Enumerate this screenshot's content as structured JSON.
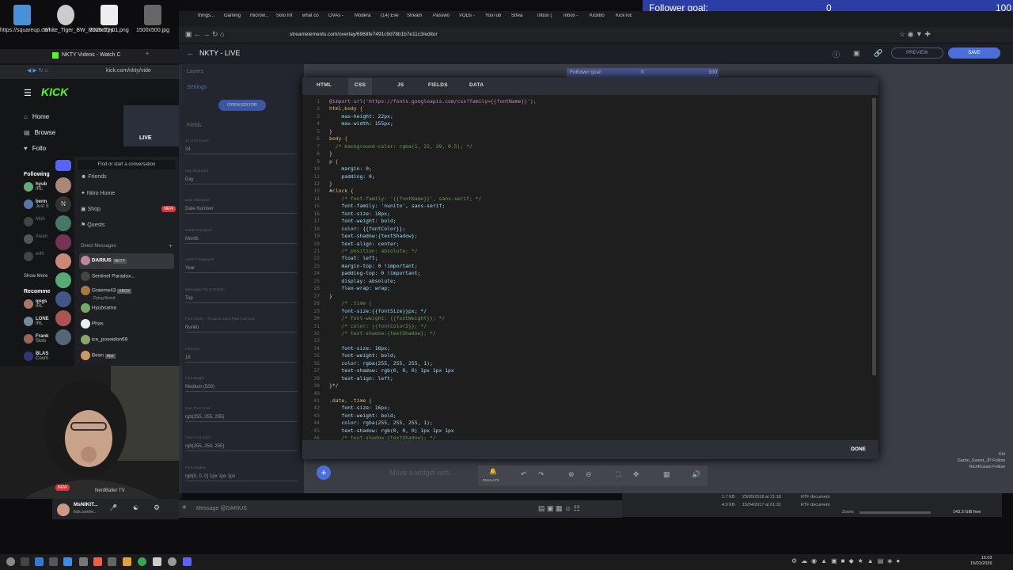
{
  "desktop": {
    "icons": [
      {
        "label": "https://squareup.com..."
      },
      {
        "label": "White_Tiger_BW_RoundTyp..."
      },
      {
        "label": "2025-12-01.png"
      },
      {
        "label": "1500x500.jpg"
      }
    ]
  },
  "follower_goal": {
    "label": "Follower goal:",
    "current": "0",
    "target": "100"
  },
  "browser": {
    "tabs": [
      "things...",
      "Gaming",
      "microw...",
      "Solo Inf",
      "what co",
      "OVAs -",
      "Modera",
      "(14) Eve",
      "Stream",
      "Passwo",
      "VODs -",
      "YouTub",
      "Strea",
      "Inbox (",
      "Inbox -",
      "KickBo",
      "KickToc"
    ],
    "url": "streamelements.com/overlay/6968fe7491c9d78b1b7e11c3/editor"
  },
  "kick": {
    "tab_title": "NKTY Videos - Watch C",
    "url": "kick.com/nkty/vide",
    "logo": "KICK",
    "nav": [
      "Home",
      "Browse",
      "Follo"
    ],
    "following_label": "Following",
    "following": [
      {
        "name": "hyub",
        "sub": "IRL"
      },
      {
        "name": "benn",
        "sub": "Just S"
      },
      {
        "name": "Moh",
        "sub": ""
      },
      {
        "name": "Asian",
        "sub": ""
      },
      {
        "name": "with",
        "sub": ""
      }
    ],
    "show_more": "Show More",
    "recommended_label": "Recomme",
    "recommended": [
      {
        "name": "qogs",
        "sub": "IRL"
      },
      {
        "name": "LONE",
        "sub": "IRL"
      },
      {
        "name": "Frank",
        "sub": "Slots"
      },
      {
        "name": "BLAS",
        "sub": "Count"
      }
    ],
    "live_badge": "LIVE"
  },
  "discord": {
    "search": "Find or start a conversation",
    "menu": [
      "Friends",
      "Nitro Home",
      "Shop",
      "Quests"
    ],
    "shop_badge": "NEW",
    "dm_header": "Direct Messages",
    "dms": [
      {
        "name": "DARIUS",
        "tag": "NKTY"
      },
      {
        "name": "Sentinel Paradox..."
      },
      {
        "name": "Graeme43",
        "tag": "XBOX",
        "sub": "Dying Breed"
      },
      {
        "name": "Hyubsama"
      },
      {
        "name": "Phas"
      },
      {
        "name": "ice_poseidon69"
      },
      {
        "name": "Bean",
        "tag": "Ape"
      },
      {
        "name": "NerdBaller TV"
      }
    ],
    "user_name": "MsNIKIT...",
    "user_sub": "kick.com/m...",
    "message_placeholder": "Message @DARIUS",
    "new_badge": "NEW"
  },
  "se": {
    "title": "NKTY - LIVE",
    "preview": "PREVIEW",
    "save": "SAVE",
    "side": {
      "layers": "Layers",
      "settings": "Settings",
      "open_editor": "OPEN EDITOR",
      "fields": "Fields",
      "rows": [
        {
          "label": "12 or 24 Hours",
          "value": "24"
        },
        {
          "label": "Day Displayed",
          "value": "Day"
        },
        {
          "label": "Date Displayed",
          "value": "Date Number"
        },
        {
          "label": "Month Displayed",
          "value": "Month"
        },
        {
          "label": "Year/Hr Displayed",
          "value": "Year"
        },
        {
          "label": "Messages Top or Bottom",
          "value": "Top"
        },
        {
          "label": "Font Family - If Custom Must Post Font Size",
          "value": "Nunito"
        },
        {
          "label": "Font size",
          "value": "16"
        },
        {
          "label": "Font Weight",
          "value": "Medium (500)"
        },
        {
          "label": "Date Font Color",
          "value": "rgb(255, 255, 255)"
        },
        {
          "label": "Time Font Color",
          "value": "rgb(255, 254, 255)"
        },
        {
          "label": "Font shadow",
          "value": "rgb(0, 0, 0) 1px 1px 1px"
        }
      ]
    },
    "modal": {
      "tabs": [
        "HTML",
        "CSS",
        "JS",
        "FIELDS",
        "DATA"
      ],
      "active_tab": "CSS",
      "done": "DONE",
      "code": [
        "@import url('https://fonts.googleapis.com/css?family={{fontName}}');",
        "html,body {",
        "    max-height: 22px;",
        "    max-width: 155px;",
        "}",
        "body {",
        "  /* background-color: rgba(1, 22, 39, 0.5); */",
        "}",
        "p {",
        "    margin: 0;",
        "    padding: 0;",
        "}",
        "#clock {",
        "    /* font-family: '{{fontName}}', sans-serif; */",
        "    font-family: 'nunito', sans-serif;",
        "    font-size: 18px;",
        "    font-weight: bold;",
        "    color: {{fontColor}};",
        "    text-shadow:{textShadow};",
        "    text-align: center;",
        "    /* position: absolute; */",
        "    float: left;",
        "    margin-top: 0 !important;",
        "    padding-top: 0 !important;",
        "    display: absolute;",
        "    flex-wrap: wrap;",
        "}",
        "    /* .time {",
        "    font-size:{{fontSize}}px; */",
        "    /* font-weight: {{fontWeight}}; */",
        "    /* color: {{fontColor2}}; */",
        "    /* text-shadow:{textShadow}; */",
        "",
        "    font-size: 16px;",
        "    font-weight: bold;",
        "    color: rgba(255, 255, 255, 1);",
        "    text-shadow: rgb(0, 0, 0) 1px 1px 1px",
        "    text-align: left;",
        "}*/",
        "",
        ".date, .time {",
        "    font-size: 16px;",
        "    font-weight: bold;",
        "    color: rgba(255, 255, 255, 1);",
        "    text-shadow: rgb(0, 0, 0) 1px 1px 1px",
        "    /* text-shadow:{textShadow}; */"
      ]
    },
    "bottom_hint": "Move a widget with...",
    "emulate": "EMULATE"
  },
  "explorer": {
    "rows": [
      {
        "size": "1.7 KB",
        "date": "23/05/2018 at 21:18",
        "type": "RTF document"
      },
      {
        "size": "4.0 KB",
        "date": "15/04/2017 at 01:31",
        "type": "RTF document"
      }
    ],
    "zoom_label": "Zoom:",
    "free": "143.3 GiB free"
  },
  "overlay_names": [
    "Kiri",
    "Garbo_Sweet_JP Follow",
    "RichRussel Follow"
  ],
  "clock": {
    "time": "15:03",
    "date": "15/01/2026"
  },
  "colors": {
    "accent": "#2c3ea6",
    "kick_green": "#53fc18",
    "se_blue": "#4a6fd8"
  }
}
